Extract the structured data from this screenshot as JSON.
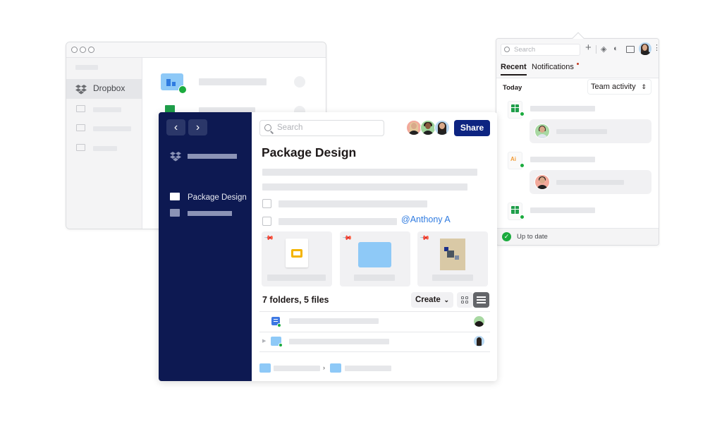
{
  "finder": {
    "window_controls": [
      "close",
      "minimize",
      "zoom"
    ],
    "sidebar": {
      "active_item": "Dropbox",
      "items": [
        "Dropbox",
        "",
        "",
        ""
      ]
    },
    "files": [
      {
        "icon": "team-folder-icon",
        "status": "synced",
        "cloud": true
      },
      {
        "icon": "spreadsheet-icon",
        "status": "online-only",
        "cloud": true
      }
    ]
  },
  "main": {
    "nav": {
      "back_label": "‹",
      "forward_label": "›",
      "items": [
        {
          "icon": "dropbox-icon",
          "label": ""
        },
        {
          "icon": "folder-icon",
          "label": "Package Design"
        },
        {
          "icon": "folder-icon",
          "label": ""
        }
      ]
    },
    "search": {
      "placeholder": "Search"
    },
    "share_label": "Share",
    "collaborators": [
      {
        "name": "collaborator-1",
        "bg": "#f2a99b"
      },
      {
        "name": "collaborator-2",
        "bg": "#9fd49b"
      },
      {
        "name": "collaborator-3",
        "bg": "#b8d8f2"
      }
    ],
    "title": "Package Design",
    "mention": "@Anthony A",
    "cards": [
      {
        "type": "slides-file"
      },
      {
        "type": "folder"
      },
      {
        "type": "image"
      }
    ],
    "count_label": "7 folders, 5 files",
    "create_label": "Create",
    "view_modes": [
      "grid",
      "list"
    ],
    "active_view": "list",
    "rows": [
      {
        "icon": "document-icon",
        "status": "synced"
      },
      {
        "icon": "team-folder-icon",
        "status": "synced",
        "expandable": true
      }
    ],
    "breadcrumb_separator": "›"
  },
  "panel": {
    "search": {
      "placeholder": "Search"
    },
    "tabs": [
      {
        "label": "Recent",
        "active": true
      },
      {
        "label": "Notifications",
        "active": false,
        "has_unread": true
      }
    ],
    "section_label": "Today",
    "filter_label": "Team activity",
    "activity": [
      {
        "icon": "spreadsheet-icon",
        "status": "synced",
        "comment_avatar_bg": "#a8d8a2"
      },
      {
        "icon": "illustrator-icon",
        "icon_text": "Ai",
        "status": "synced",
        "comment_avatar_bg": "#f2a99b"
      },
      {
        "icon": "spreadsheet-icon",
        "status": "synced"
      }
    ],
    "footer_label": "Up to date",
    "colors": {
      "accent": "#0d2481",
      "sync_green": "#1bab3e",
      "nav_bg": "#0d1952",
      "mention": "#2f7be0"
    }
  }
}
